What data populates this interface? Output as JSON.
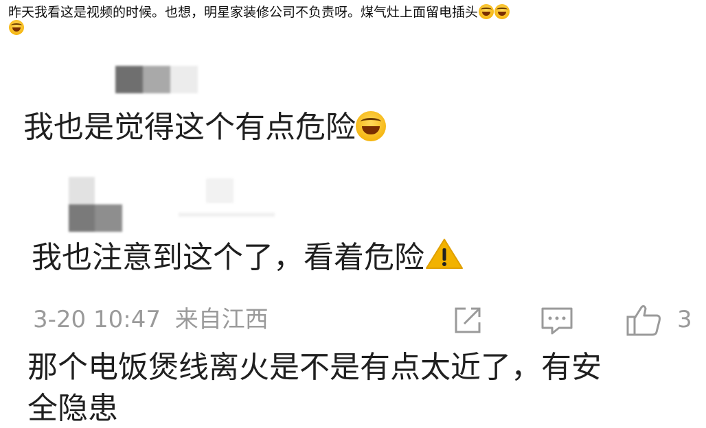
{
  "post": {
    "text": "昨天我看这是视频的时候。也想，明星家装修公司不负责呀。煤气灶上面留电插头",
    "emoji_names": [
      "crying-laughing-emoji",
      "crying-laughing-emoji",
      "crying-laughing-emoji"
    ]
  },
  "comments": [
    {
      "text": "我也是觉得这个有点危险",
      "emoji_name": "crying-laughing-emoji"
    },
    {
      "text": "我也注意到这个了，看着危险",
      "emoji_name": "warning-icon"
    }
  ],
  "meta": {
    "timestamp": "3-20 10:47",
    "location": "来自江西",
    "like_count": "3"
  },
  "next_comment": {
    "text": "那个电饭煲线离火是不是有点太近了，有安",
    "cut_line": "全隐患"
  },
  "colors": {
    "text": "#1f1f1f",
    "meta": "#9a9a9a",
    "warning": "#f2b200"
  }
}
